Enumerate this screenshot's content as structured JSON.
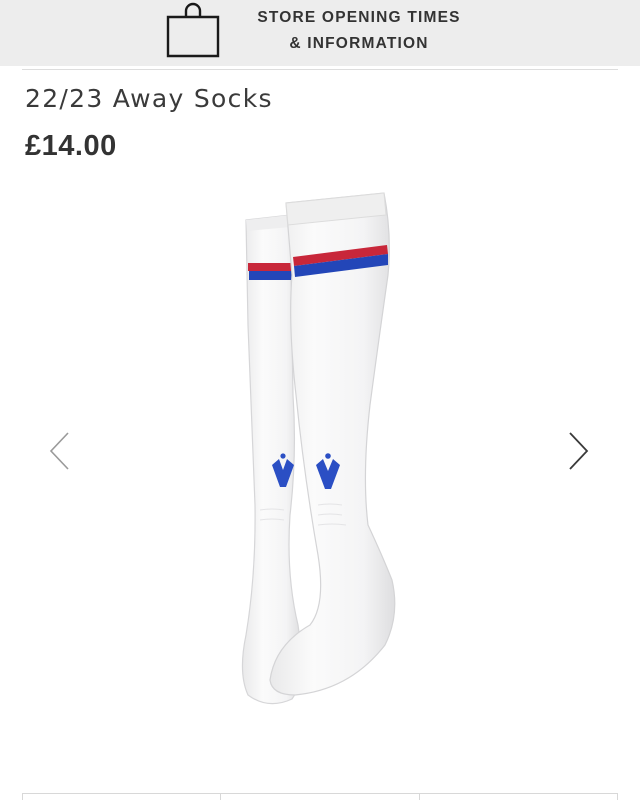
{
  "banner": {
    "line1": "STORE OPENING TIMES",
    "line2": "& INFORMATION",
    "icon": "shopping-bag-icon"
  },
  "product": {
    "title": "22/23 Away Socks",
    "price": "£14.00",
    "image_subject": "white football socks with red and blue stripe",
    "colors": {
      "sock": "#f7f7f7",
      "stripe_red": "#c8273a",
      "stripe_blue": "#2346b8",
      "logo": "#2b4fc4"
    }
  },
  "gallery": {
    "prev_icon": "chevron-left-icon",
    "next_icon": "chevron-right-icon"
  }
}
